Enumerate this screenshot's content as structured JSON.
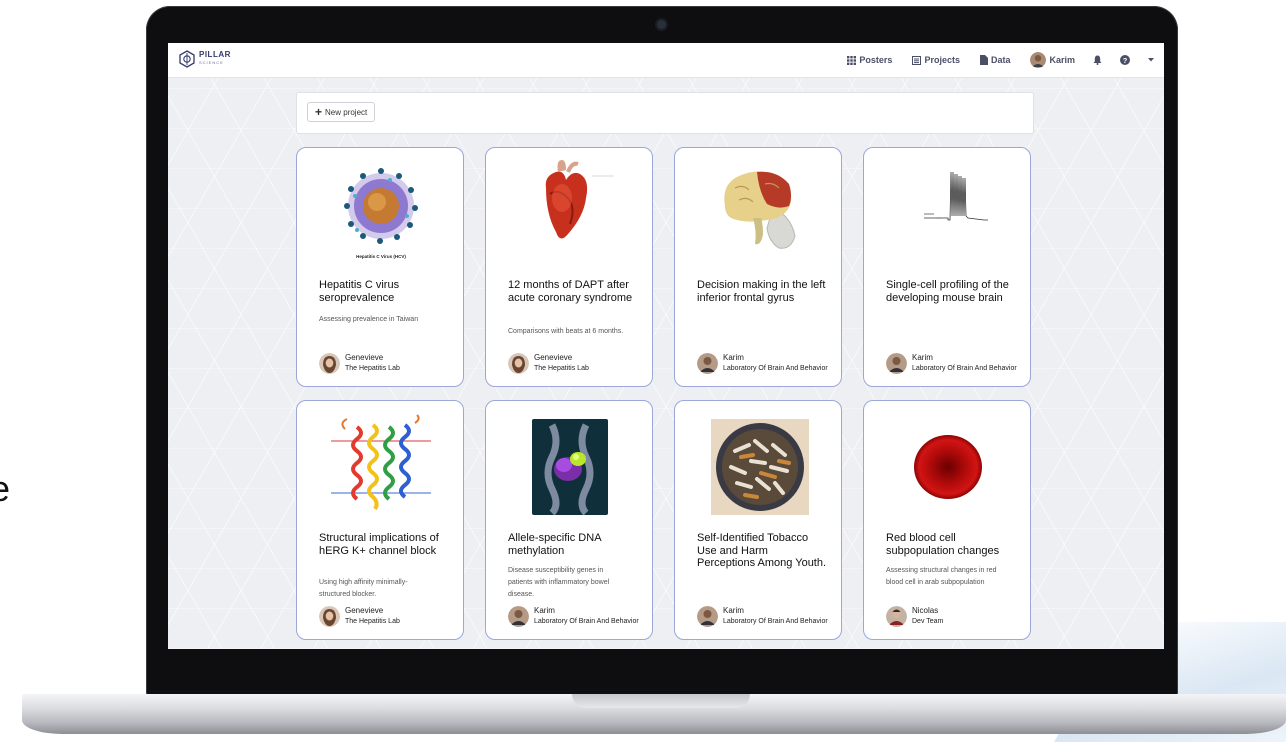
{
  "colors": {
    "card_border": "#9ba7d9",
    "brand": "#32396b",
    "screen_bg": "#eeeff2"
  },
  "brand": {
    "name": "PILLAR",
    "sub": "SCIENCE"
  },
  "nav": {
    "posters_label": "Posters",
    "projects_label": "Projects",
    "data_label": "Data",
    "user_label": "Karim",
    "icons": [
      "grid-icon",
      "list-icon",
      "file-icon",
      "bell-icon",
      "help-icon",
      "caret-down-icon"
    ]
  },
  "toolbar": {
    "new_project_label": "New project"
  },
  "cards": [
    {
      "title": "Hepatitis C virus seroprevalence",
      "description": "Assessing prevalence in Taiwan",
      "image_caption": "Hepatitis C Virus (HCV)",
      "author_name": "Genevieve",
      "author_lab": "The Hepatitis Lab"
    },
    {
      "title": "12 months of DAPT after acute coronary syndrome",
      "description": "Comparisons with beats at 6 months.",
      "author_name": "Genevieve",
      "author_lab": "The Hepatitis Lab"
    },
    {
      "title": "Decision making in the left inferior frontal gyrus",
      "description": "",
      "author_name": "Karim",
      "author_lab": "Laboratory Of Brain And Behavior"
    },
    {
      "title": "Single-cell profiling of the developing mouse brain",
      "description": "",
      "author_name": "Karim",
      "author_lab": "Laboratory Of Brain And Behavior"
    },
    {
      "title": "Structural implications of hERG K+ channel block",
      "description": "Using high affinity minimally-structured blocker.",
      "author_name": "Genevieve",
      "author_lab": "The Hepatitis Lab"
    },
    {
      "title": "Allele-specific DNA methylation",
      "description": "Disease susceptibility genes in patients with inflammatory bowel disease.",
      "author_name": "Karim",
      "author_lab": "Laboratory Of Brain And Behavior"
    },
    {
      "title": "Self-Identified Tobacco Use and Harm Perceptions Among Youth.",
      "description": "",
      "author_name": "Karim",
      "author_lab": "Laboratory Of Brain And Behavior"
    },
    {
      "title": "Red blood cell subpopulation changes",
      "description": "Assessing structural changes in red blood cell in arab subpopulation",
      "author_name": "Nicolas",
      "author_lab": "Dev Team"
    }
  ],
  "background": {
    "stray_text": "e"
  }
}
